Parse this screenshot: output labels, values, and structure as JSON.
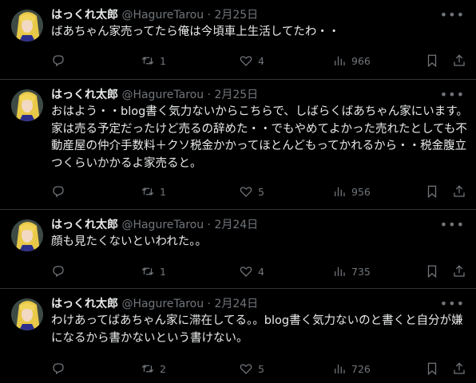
{
  "tweets": [
    {
      "name": "はっくれ太郎",
      "handle": "@HagureTarou",
      "date": "2月25日",
      "text": "ばあちゃん家売ってたら俺は今頃車上生活してたわ・・",
      "replies": "",
      "retweets": "1",
      "likes": "4",
      "views": "966"
    },
    {
      "name": "はっくれ太郎",
      "handle": "@HagureTarou",
      "date": "2月25日",
      "text": "おはよう・・blog書く気力ないからこちらで、しばらくばあちゃん家にいます。家は売る予定だったけど売るの辞めた・・でもやめてよかった売れたとしても不動産屋の仲介手数料＋クソ税金かかってほとんどもってかれるから・・税金腹立つくらいかかるよ家売ると。",
      "replies": "",
      "retweets": "1",
      "likes": "5",
      "views": "956"
    },
    {
      "name": "はっくれ太郎",
      "handle": "@HagureTarou",
      "date": "2月24日",
      "text": "顔も見たくないといわれた。。",
      "replies": "",
      "retweets": "1",
      "likes": "4",
      "views": "735"
    },
    {
      "name": "はっくれ太郎",
      "handle": "@HagureTarou",
      "date": "2月24日",
      "text": "わけあってばあちゃん家に滞在してる。。blog書く気力ないのと書くと自分が嫌になるから書かないという書けない。",
      "replies": "",
      "retweets": "2",
      "likes": "5",
      "views": "726"
    }
  ],
  "icons": {
    "reply": "reply-icon",
    "retweet": "retweet-icon",
    "like": "heart-icon",
    "views": "views-icon",
    "bookmark": "bookmark-icon",
    "share": "share-icon",
    "more": "more-icon"
  },
  "colors": {
    "background": "#000000",
    "text": "#e7e9ea",
    "muted": "#71767b",
    "divider": "#2f3336"
  }
}
